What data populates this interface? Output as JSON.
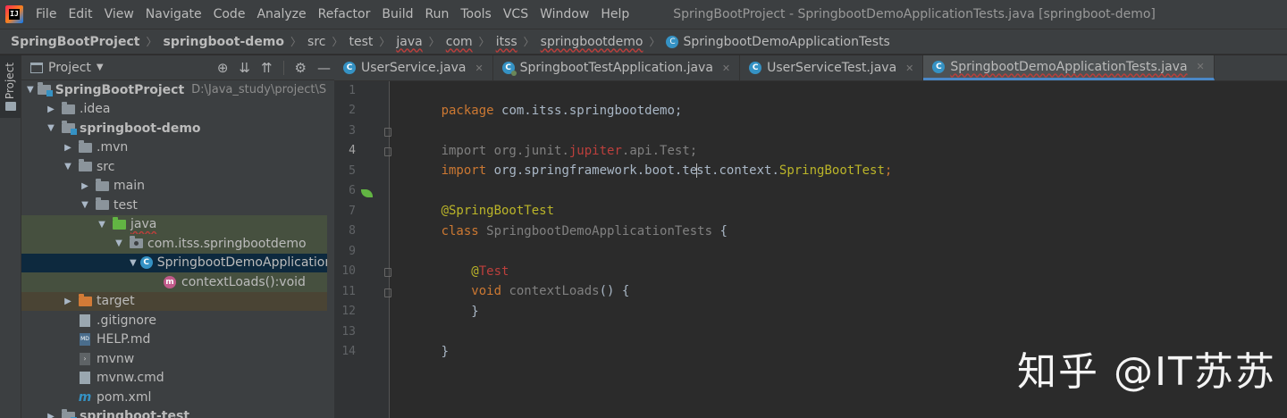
{
  "menubar": {
    "items": [
      "File",
      "Edit",
      "View",
      "Navigate",
      "Code",
      "Analyze",
      "Refactor",
      "Build",
      "Run",
      "Tools",
      "VCS",
      "Window",
      "Help"
    ],
    "window_title": "SpringBootProject - SpringbootDemoApplicationTests.java [springboot-demo]"
  },
  "breadcrumb": {
    "items": [
      "SpringBootProject",
      "springboot-demo",
      "src",
      "test",
      "java",
      "com",
      "itss",
      "springbootdemo",
      "SpringbootDemoApplicationTests"
    ]
  },
  "tool_strip": {
    "project_label": "Project"
  },
  "project_panel": {
    "title": "Project",
    "tools": {
      "locate": "⊕",
      "expand": "⇊",
      "collapse": "⇈",
      "settings": "⚙",
      "hide": "—"
    },
    "tree": [
      {
        "label": "SpringBootProject",
        "hint": "D:\\Java_study\\project\\Spring"
      },
      {
        "label": ".idea"
      },
      {
        "label": "springboot-demo"
      },
      {
        "label": ".mvn"
      },
      {
        "label": "src"
      },
      {
        "label": "main"
      },
      {
        "label": "test"
      },
      {
        "label": "java"
      },
      {
        "label": "com.itss.springbootdemo"
      },
      {
        "label": "SpringbootDemoApplicationTests"
      },
      {
        "label": "contextLoads():void"
      },
      {
        "label": "target"
      },
      {
        "label": ".gitignore"
      },
      {
        "label": "HELP.md"
      },
      {
        "label": "mvnw"
      },
      {
        "label": "mvnw.cmd"
      },
      {
        "label": "pom.xml"
      },
      {
        "label": "springboot-test"
      }
    ]
  },
  "tabs": [
    {
      "label": "UserService.java"
    },
    {
      "label": "SpringbootTestApplication.java"
    },
    {
      "label": "UserServiceTest.java"
    },
    {
      "label": "SpringbootDemoApplicationTests.java"
    }
  ],
  "editor": {
    "line_numbers": [
      "1",
      "2",
      "3",
      "4",
      "5",
      "6",
      "7",
      "8",
      "9",
      "10",
      "11",
      "12",
      "13",
      "14"
    ],
    "code": {
      "l1_kw": "package",
      "l1_rest": " com.itss.springbootdemo;",
      "l3_a": "import org.junit.",
      "l3_b": "jupiter",
      "l3_c": ".api.Test;",
      "l4_kw": "import",
      "l4_a": " org.springframework.boot.te",
      "l4_b": "st.context.",
      "l4_c": "SpringBootTest",
      "l4_d": ";",
      "l6": "@SpringBootTest",
      "l7_kw": "class",
      "l7_name": " SpringbootDemoApplicationTests",
      "l7_brace": " {",
      "l9_at": "    @",
      "l9_name": "Test",
      "l10_kw": "    void",
      "l10_name": " contextLoads",
      "l10_rest": "() {",
      "l11": "    }",
      "l13": "}"
    }
  },
  "watermark": "知乎 @IT苏苏"
}
